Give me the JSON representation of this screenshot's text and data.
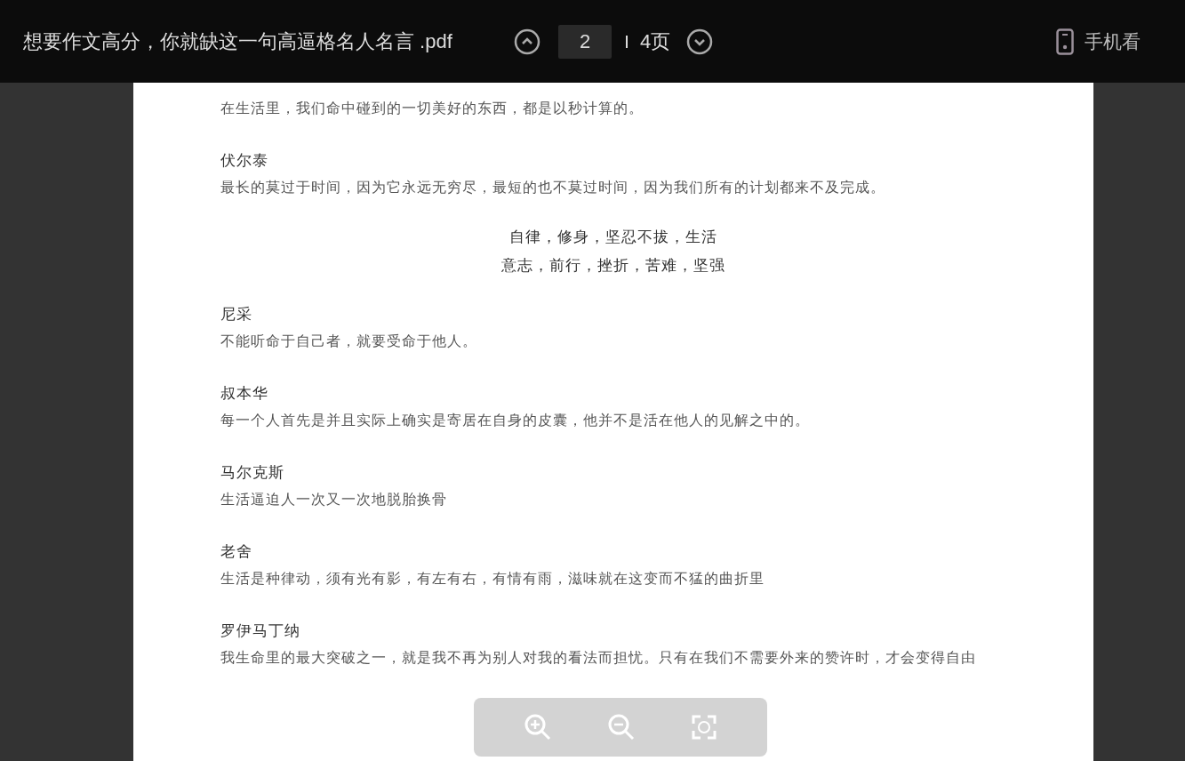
{
  "header": {
    "title": "想要作文高分，你就缺这一句高逼格名人名言 .pdf",
    "page_input": {
      "value": "2"
    },
    "page_total": "4页",
    "mobile_label": "手机看"
  },
  "document": {
    "entries": [
      {
        "kind": "text",
        "text": "在生活里，我们命中碰到的一切美好的东西，都是以秒计算的。"
      },
      {
        "kind": "quote",
        "author": "伏尔泰",
        "text": "最长的莫过于时间，因为它永远无穷尽，最短的也不莫过时间，因为我们所有的计划都来不及完成。"
      },
      {
        "kind": "center",
        "lines": [
          "自律，修身，坚忍不拔，生活",
          "意志，前行，挫折，苦难，坚强"
        ]
      },
      {
        "kind": "quote",
        "author": "尼采",
        "text": "不能听命于自己者，就要受命于他人。"
      },
      {
        "kind": "quote",
        "author": "叔本华",
        "text": "每一个人首先是并且实际上确实是寄居在自身的皮囊，他并不是活在他人的见解之中的。"
      },
      {
        "kind": "quote",
        "author": "马尔克斯",
        "text": "生活逼迫人一次又一次地脱胎换骨"
      },
      {
        "kind": "quote",
        "author": "老舍",
        "text": "生活是种律动，须有光有影，有左有右，有情有雨，滋味就在这变而不猛的曲折里"
      },
      {
        "kind": "quote",
        "author": "罗伊马丁纳",
        "text": "我生命里的最大突破之一，就是我不再为别人对我的看法而担忧。只有在我们不需要外来的赞许时，才会变得自由"
      }
    ]
  }
}
